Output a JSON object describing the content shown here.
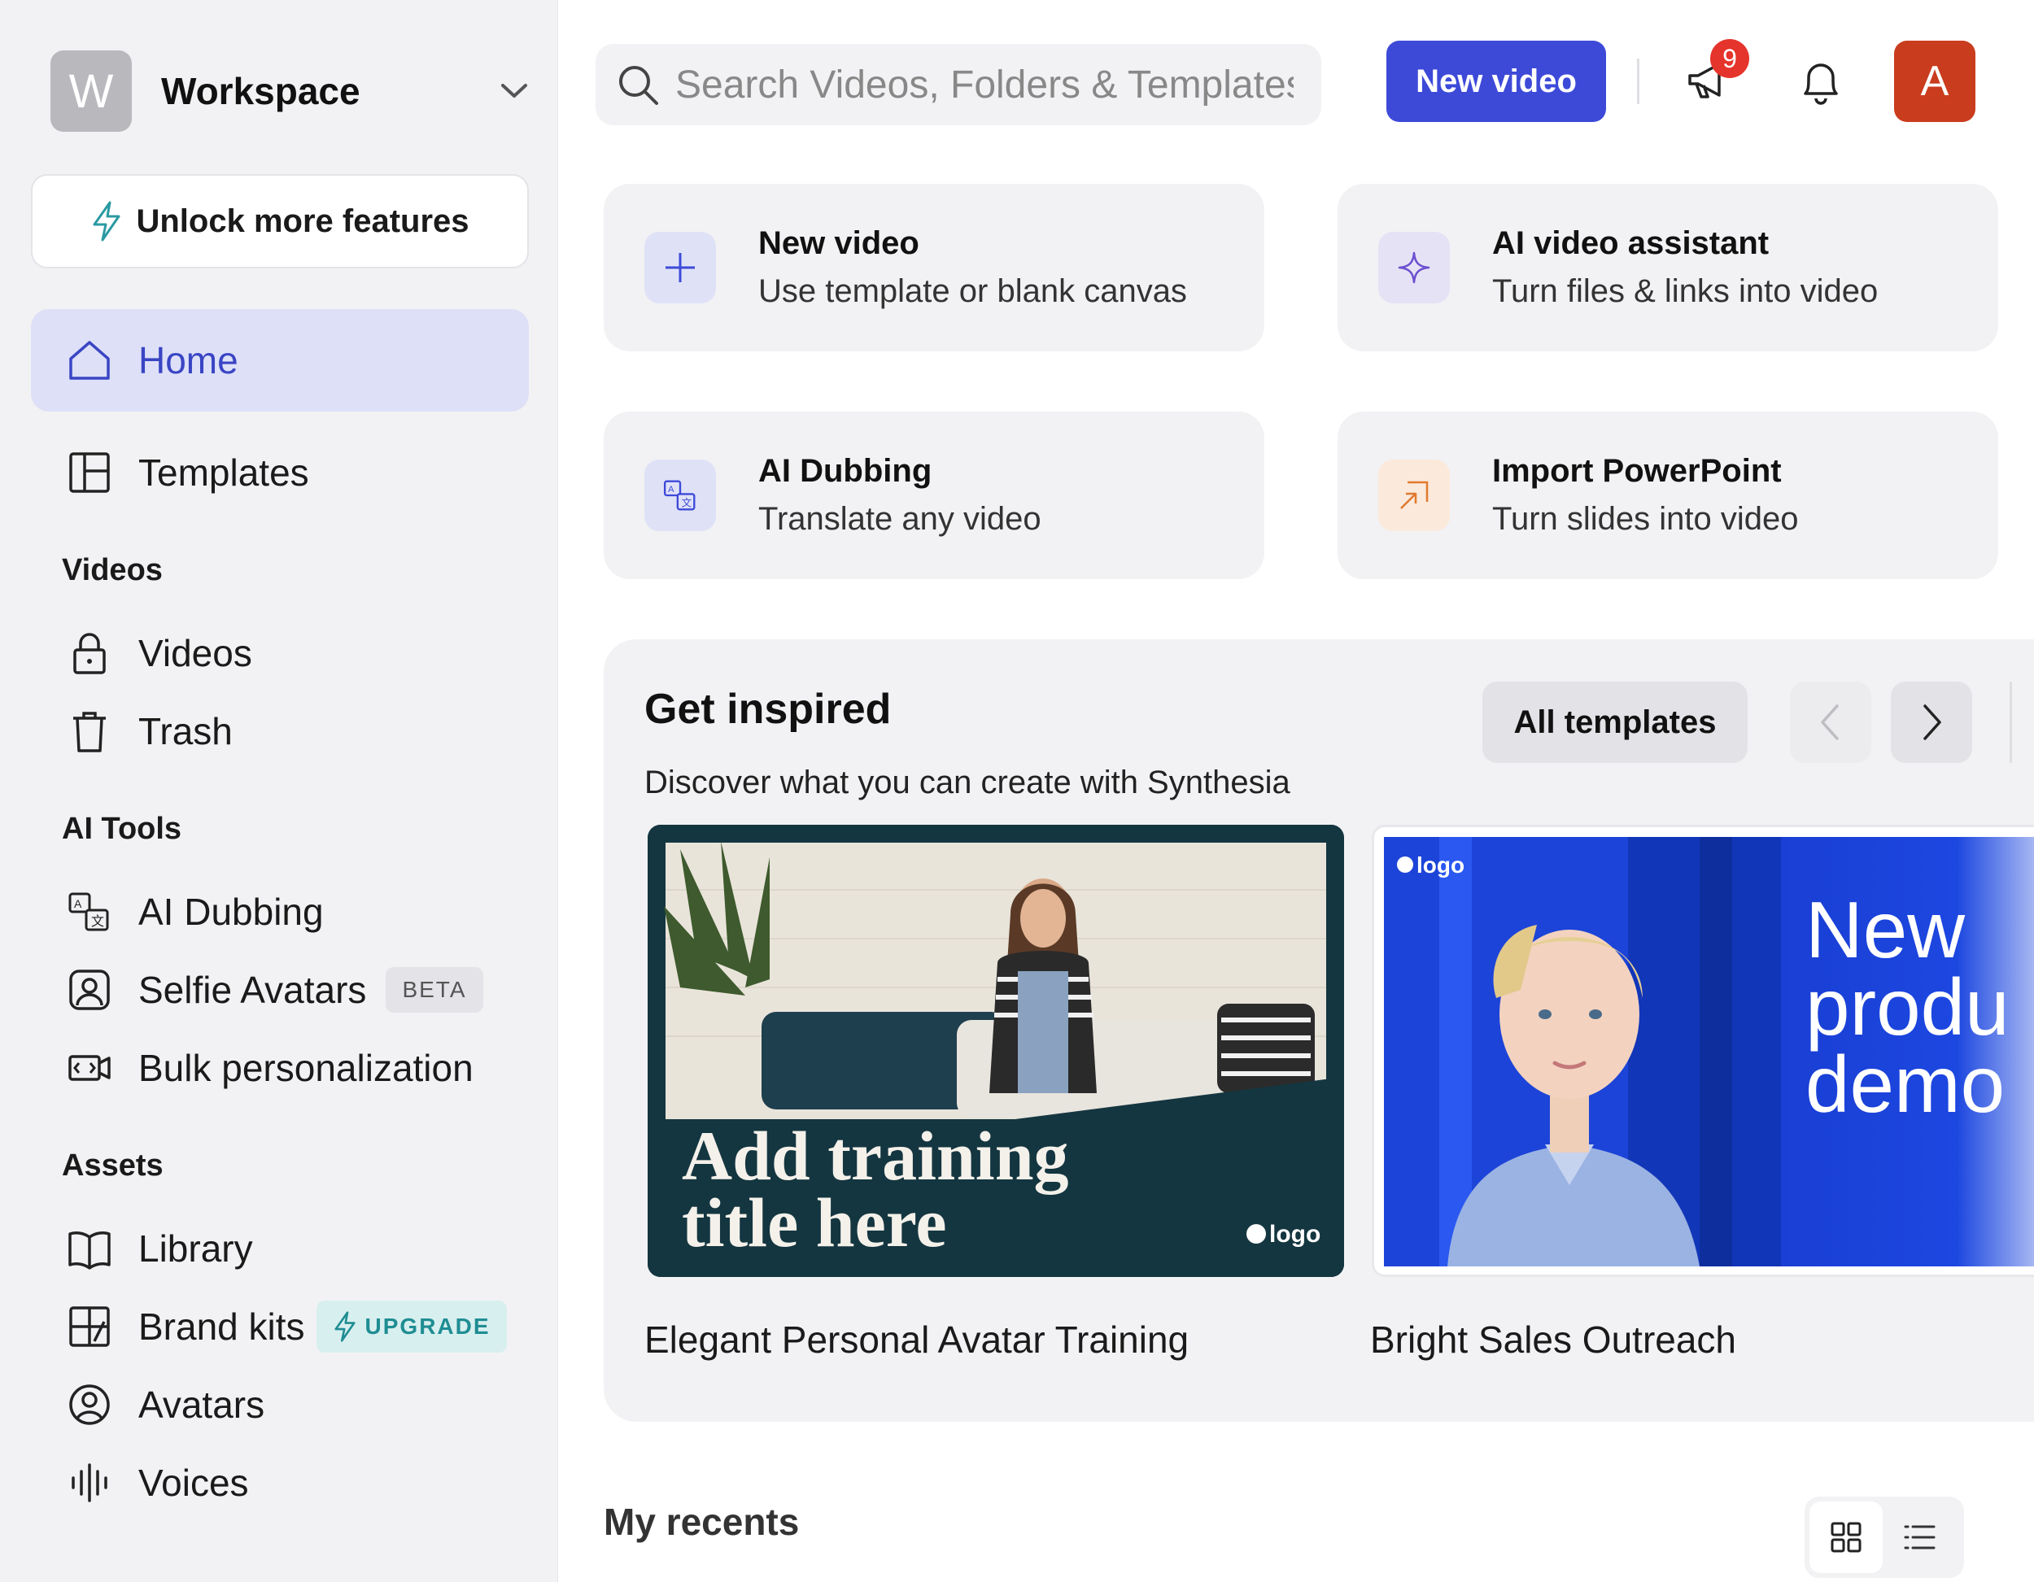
{
  "workspace": {
    "initial": "W",
    "name": "Workspace"
  },
  "sidebar": {
    "unlock_label": "Unlock more features",
    "home_label": "Home",
    "templates_label": "Templates",
    "sections": {
      "videos": "Videos",
      "ai_tools": "AI Tools",
      "assets": "Assets"
    },
    "videos_items": {
      "videos": "Videos",
      "trash": "Trash"
    },
    "ai_tools_items": {
      "ai_dubbing": "AI Dubbing",
      "selfie_avatars": "Selfie Avatars",
      "selfie_badge": "BETA",
      "bulk": "Bulk personalization"
    },
    "assets_items": {
      "library": "Library",
      "brand_kits": "Brand kits",
      "brand_badge": "UPGRADE",
      "avatars": "Avatars",
      "voices": "Voices"
    }
  },
  "header": {
    "search_placeholder": "Search Videos, Folders & Templates",
    "new_video_label": "New video",
    "notification_count": "9",
    "user_initial": "A"
  },
  "actions": [
    {
      "title": "New video",
      "subtitle": "Use template or blank canvas"
    },
    {
      "title": "AI video assistant",
      "subtitle": "Turn files & links into video"
    },
    {
      "title": "AI Dubbing",
      "subtitle": "Translate any video"
    },
    {
      "title": "Import PowerPoint",
      "subtitle": "Turn slides into video"
    }
  ],
  "inspired": {
    "title": "Get inspired",
    "subtitle": "Discover what you can create with Synthesia",
    "all_templates_label": "All templates",
    "templates": [
      {
        "name": "Elegant Personal Avatar Training",
        "overlay_line1": "Add training",
        "overlay_line2": "title here",
        "logo": "logo"
      },
      {
        "name": "Bright Sales Outreach",
        "overlay_line1": "New",
        "overlay_line2": "produ",
        "overlay_line3": "demo",
        "logo": "logo"
      }
    ]
  },
  "recents": {
    "title": "My recents"
  },
  "colors": {
    "accent": "#3d4ad8",
    "home_active_bg": "#dde0f7",
    "notification": "#e5342b",
    "user_avatar": "#c93c1d",
    "upgrade_badge": "#1f8d93"
  }
}
